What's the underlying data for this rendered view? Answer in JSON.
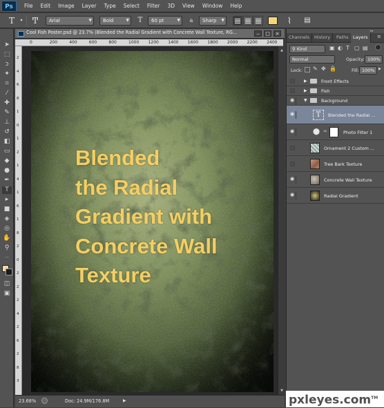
{
  "app": {
    "logo": "Ps",
    "menu": [
      "File",
      "Edit",
      "Image",
      "Layer",
      "Type",
      "Select",
      "Filter",
      "3D",
      "View",
      "Window",
      "Help"
    ]
  },
  "options_bar": {
    "font_family": "Arial",
    "font_style": "Bold",
    "font_size": "60 pt",
    "antialias_label": "a",
    "antialias": "Sharp",
    "text_color": "#f5d77a"
  },
  "document": {
    "tab_title": "Cool Fish Poster.psd @ 23.7% (Blended the Radial Gradient with Concrete Wall Texture, RG...",
    "ruler_h_ticks": [
      "0",
      "200",
      "400",
      "600",
      "800",
      "1000",
      "1200",
      "1400",
      "1600",
      "1800",
      "2000",
      "2200",
      "2400"
    ],
    "ruler_v_ticks": [
      "2",
      "4",
      "6",
      "8",
      "1",
      "0",
      "1",
      "2",
      "1",
      "4",
      "1",
      "6",
      "1",
      "8",
      "2",
      "0",
      "2",
      "2",
      "2",
      "4",
      "2",
      "6",
      "2",
      "8",
      "3"
    ],
    "poster_text": [
      "Blended",
      "the Radial",
      "Gradient with",
      "Concrete Wall",
      "Texture"
    ],
    "poster_text_color": "#f4ce63"
  },
  "status": {
    "zoom": "23.68%",
    "doc_size": "Doc: 24.9M/176.8M"
  },
  "layers_panel": {
    "tabs": [
      "Channels",
      "History",
      "Paths",
      "Layers"
    ],
    "filter_kind": "Kind",
    "blend_mode": "Normal",
    "opacity_label": "Opacity:",
    "opacity": "100%",
    "lock_label": "Lock:",
    "fill_label": "Fill:",
    "fill": "100%",
    "layers": [
      {
        "name": "Front Effects",
        "kind": "group",
        "collapsed": true,
        "visible": false
      },
      {
        "name": "Fish",
        "kind": "group",
        "collapsed": true,
        "visible": false
      },
      {
        "name": "Background",
        "kind": "group",
        "collapsed": false,
        "visible": true
      },
      {
        "name": "Blended the Radial ...",
        "kind": "text",
        "visible": true,
        "selected": true
      },
      {
        "name": "Photo Filter 1",
        "kind": "adjustment",
        "visible": true
      },
      {
        "name": "Ornament 2 Custom ...",
        "kind": "pixel",
        "visible": false
      },
      {
        "name": "Tree Bark Texture",
        "kind": "pixel",
        "visible": false
      },
      {
        "name": "Concrete Wall Texture",
        "kind": "pixel",
        "visible": true
      },
      {
        "name": "Radial Gradient",
        "kind": "pixel",
        "visible": true
      }
    ]
  },
  "watermark": {
    "text": "pxleyes.com",
    "symbol": "TM"
  }
}
